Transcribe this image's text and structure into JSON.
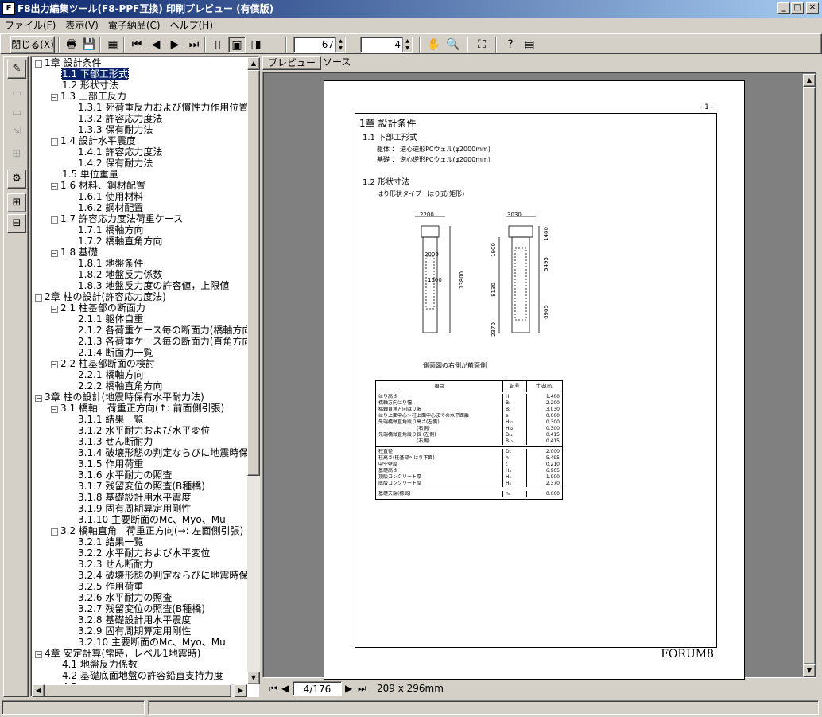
{
  "window": {
    "title": "F8出力編集ツール(F8-PPF互換) 印刷プレビュー (有償版)"
  },
  "menu": [
    "ファイル(F)",
    "表示(V)",
    "電子納品(C)",
    "ヘルプ(H)"
  ],
  "toolbar": {
    "close_label": "閉じる(X)",
    "zoom_value": "67",
    "page_value": "4"
  },
  "tree": [
    {
      "text": "1章 設計条件",
      "level": 0,
      "box": "−"
    },
    {
      "text": "1.1 下部工形式",
      "level": 1,
      "selected": true
    },
    {
      "text": "1.2 形状寸法",
      "level": 1
    },
    {
      "text": "1.3 上部工反力",
      "level": 1,
      "box": "−"
    },
    {
      "text": "1.3.1 死荷重反力および慣性力作用位置",
      "level": 2
    },
    {
      "text": "1.3.2 許容応力度法",
      "level": 2
    },
    {
      "text": "1.3.3 保有耐力法",
      "level": 2
    },
    {
      "text": "1.4 設計水平震度",
      "level": 1,
      "box": "−"
    },
    {
      "text": "1.4.1 許容応力度法",
      "level": 2
    },
    {
      "text": "1.4.2 保有耐力法",
      "level": 2
    },
    {
      "text": "1.5 単位重量",
      "level": 1
    },
    {
      "text": "1.6 材料、鋼材配置",
      "level": 1,
      "box": "−"
    },
    {
      "text": "1.6.1 使用材料",
      "level": 2
    },
    {
      "text": "1.6.2 鋼材配置",
      "level": 2
    },
    {
      "text": "1.7 許容応力度法荷重ケース",
      "level": 1,
      "box": "−"
    },
    {
      "text": "1.7.1 橋軸方向",
      "level": 2
    },
    {
      "text": "1.7.2 橋軸直角方向",
      "level": 2
    },
    {
      "text": "1.8 基礎",
      "level": 1,
      "box": "−"
    },
    {
      "text": "1.8.1 地盤条件",
      "level": 2
    },
    {
      "text": "1.8.2 地盤反力係数",
      "level": 2
    },
    {
      "text": "1.8.3 地盤反力度の許容値，上限値",
      "level": 2
    },
    {
      "text": "2章 柱の設計(許容応力度法)",
      "level": 0,
      "box": "−"
    },
    {
      "text": "2.1 柱基部の断面力",
      "level": 1,
      "box": "−"
    },
    {
      "text": "2.1.1 躯体自重",
      "level": 2
    },
    {
      "text": "2.1.2 各荷重ケース毎の断面力(橋軸方向)",
      "level": 2
    },
    {
      "text": "2.1.3 各荷重ケース毎の断面力(直角方向)",
      "level": 2
    },
    {
      "text": "2.1.4 断面力一覧",
      "level": 2
    },
    {
      "text": "2.2 柱基部断面の検討",
      "level": 1,
      "box": "−"
    },
    {
      "text": "2.2.1 橋軸方向",
      "level": 2
    },
    {
      "text": "2.2.2 橋軸直角方向",
      "level": 2
    },
    {
      "text": "3章 柱の設計(地震時保有水平耐力法)",
      "level": 0,
      "box": "−"
    },
    {
      "text": "3.1 橋軸　荷重正方向(↑: 前面側引張)",
      "level": 1,
      "box": "−"
    },
    {
      "text": "3.1.1 結果一覧",
      "level": 2
    },
    {
      "text": "3.1.2 水平耐力および水平変位",
      "level": 2
    },
    {
      "text": "3.1.3 せん断耐力",
      "level": 2
    },
    {
      "text": "3.1.4 破壊形態の判定ならびに地震時保有",
      "level": 2
    },
    {
      "text": "3.1.5 作用荷重",
      "level": 2
    },
    {
      "text": "3.1.6 水平耐力の照査",
      "level": 2
    },
    {
      "text": "3.1.7 残留変位の照査(B種橋)",
      "level": 2
    },
    {
      "text": "3.1.8 基礎設計用水平震度",
      "level": 2
    },
    {
      "text": "3.1.9 固有周期算定用剛性",
      "level": 2
    },
    {
      "text": "3.1.10 主要断面のMc、Myo、Mu",
      "level": 2
    },
    {
      "text": "3.2 橋軸直角　荷重正方向(→: 左面側引張)",
      "level": 1,
      "box": "−"
    },
    {
      "text": "3.2.1 結果一覧",
      "level": 2
    },
    {
      "text": "3.2.2 水平耐力および水平変位",
      "level": 2
    },
    {
      "text": "3.2.3 せん断耐力",
      "level": 2
    },
    {
      "text": "3.2.4 破壊形態の判定ならびに地震時保有",
      "level": 2
    },
    {
      "text": "3.2.5 作用荷重",
      "level": 2
    },
    {
      "text": "3.2.6 水平耐力の照査",
      "level": 2
    },
    {
      "text": "3.2.7 残留変位の照査(B種橋)",
      "level": 2
    },
    {
      "text": "3.2.8 基礎設計用水平震度",
      "level": 2
    },
    {
      "text": "3.2.9 固有周期算定用剛性",
      "level": 2
    },
    {
      "text": "3.2.10 主要断面のMc、Myo、Mu",
      "level": 2
    },
    {
      "text": "4章 安定計算(常時，レベル1地震時)",
      "level": 0,
      "box": "−"
    },
    {
      "text": "4.1 地盤反力係数",
      "level": 1
    },
    {
      "text": "4.2 基礎底面地盤の許容鉛直支持力度",
      "level": 1
    },
    {
      "text": "4.3 ...",
      "level": 1
    }
  ],
  "tabs": [
    "プレビュー",
    "ソース"
  ],
  "nav": {
    "page": "4/176",
    "size": "209 x 296mm"
  },
  "doc": {
    "page_no": "- 1 -",
    "chapter": "1章 設計条件",
    "s11": "1.1 下部工形式",
    "body_line": "躯体 ： 逆心逆形PCウェル(φ2000mm)",
    "base_line": "基礎 ： 逆心逆形PCウェル(φ2000mm)",
    "s12": "1.2 形状寸法",
    "shape_type": "はり形状タイプ　はり式(矩形)",
    "caption": "側面図の右側が前面側",
    "footer": "FORUM8",
    "dims_left": [
      "2200",
      "2000",
      "1500",
      "13800"
    ],
    "dims_right": [
      "3030",
      "1400",
      "1900",
      "5495",
      "8130",
      "6905",
      "2370"
    ],
    "table_head": [
      "項目",
      "記号",
      "寸法(m)"
    ],
    "table_g1": [
      [
        "はり高さ",
        "H",
        "1.400"
      ],
      [
        "橋軸方向はり幅",
        "B₁",
        "2.200"
      ],
      [
        "橋軸直角方向はり幅",
        "B₂",
        "3.030"
      ],
      [
        "はり上面中心〜柱上面中心までの水平距離",
        "e",
        "0.000"
      ],
      [
        "先端橋軸直角段り高さ(左側)",
        "H₄₁",
        "0.300"
      ],
      [
        "　　　　　　　　(右側)",
        "H₄₂",
        "0.300"
      ],
      [
        "先端橋軸直角段り長 (左側)",
        "B₄₁",
        "0.415"
      ],
      [
        "　　　　　　　　(右側)",
        "B₄₂",
        "0.415"
      ]
    ],
    "table_g2": [
      [
        "柱直径",
        "D₁",
        "2.000"
      ],
      [
        "柱高さ(柱基部〜はり下面)",
        "h",
        "5.495"
      ],
      [
        "中空壁厚",
        "t",
        "0.210"
      ],
      [
        "基礎高さ",
        "H₃",
        "6.905"
      ],
      [
        "頂版コンクリート厚",
        "H₅",
        "1.900"
      ],
      [
        "底版コンクリート厚",
        "H₆",
        "2.370"
      ]
    ],
    "table_g3": [
      [
        "基礎天端(標高)",
        "h₀",
        "0.000"
      ]
    ]
  },
  "colors": {
    "title_start": "#0a246a",
    "title_end": "#a6caf0",
    "selection": "#0a246a"
  }
}
